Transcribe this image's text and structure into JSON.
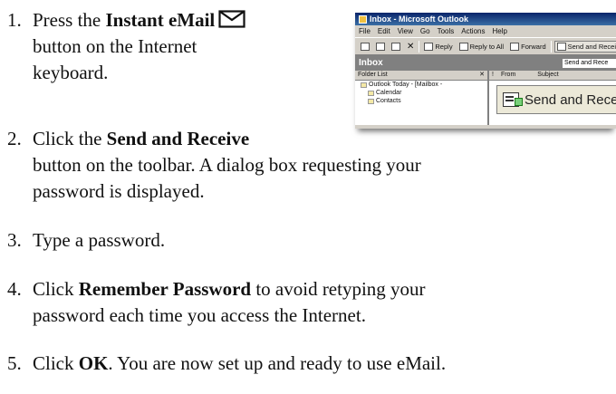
{
  "steps": [
    {
      "number": "1.",
      "lines": [
        [
          "Press the ",
          {
            "b": "Instant eMail"
          }
        ],
        [
          "button on the Internet"
        ],
        [
          "keyboard."
        ]
      ]
    },
    {
      "number": "2.",
      "lines": [
        [
          {
            "b": "Click the "
          },
          {
            "b": "Send and Receive"
          }
        ]
      ]
    }
  ],
  "step1": {
    "number": "1.",
    "line1_pre": "Press the ",
    "line1_bold": "Instant eMail",
    "line2": "button on the Internet",
    "line3": "keyboard.",
    "icon": "envelope-icon"
  },
  "step2": {
    "number": "2.",
    "line1_pre": "Click the ",
    "line1_bold": "Send and Receive",
    "line2": "button on the toolbar. A dialog box requesting your",
    "line3": "password is displayed."
  },
  "step3": {
    "number": "3.",
    "line1": "Type a password."
  },
  "step4": {
    "number": "4.",
    "line1_pre": "Click ",
    "line1_bold": "Remember Password",
    "line1_post": " to avoid retyping your",
    "line2": "password each time you access the Internet."
  },
  "step5": {
    "number": "5.",
    "line1_pre": "Click ",
    "line1_bold": "OK",
    "line1_post": ". You are now set up and ready to use eMail."
  },
  "screenshot": {
    "title": "Inbox - Microsoft Outlook",
    "menu": [
      "File",
      "Edit",
      "View",
      "Go",
      "Tools",
      "Actions",
      "Help"
    ],
    "toolbar": {
      "reply": "Reply",
      "reply_all": "Reply to All",
      "forward": "Forward",
      "send_receive": "Send and Receive"
    },
    "inbox_label": "Inbox",
    "combo_text": "Send and Rece",
    "folder_list_header": "Folder List",
    "folders": [
      "Outlook Today - [Mailbox -",
      "Calendar",
      "Contacts"
    ],
    "columns": [
      "!",
      "From",
      "Subject"
    ],
    "big_button_label": "Send and Receiv"
  }
}
